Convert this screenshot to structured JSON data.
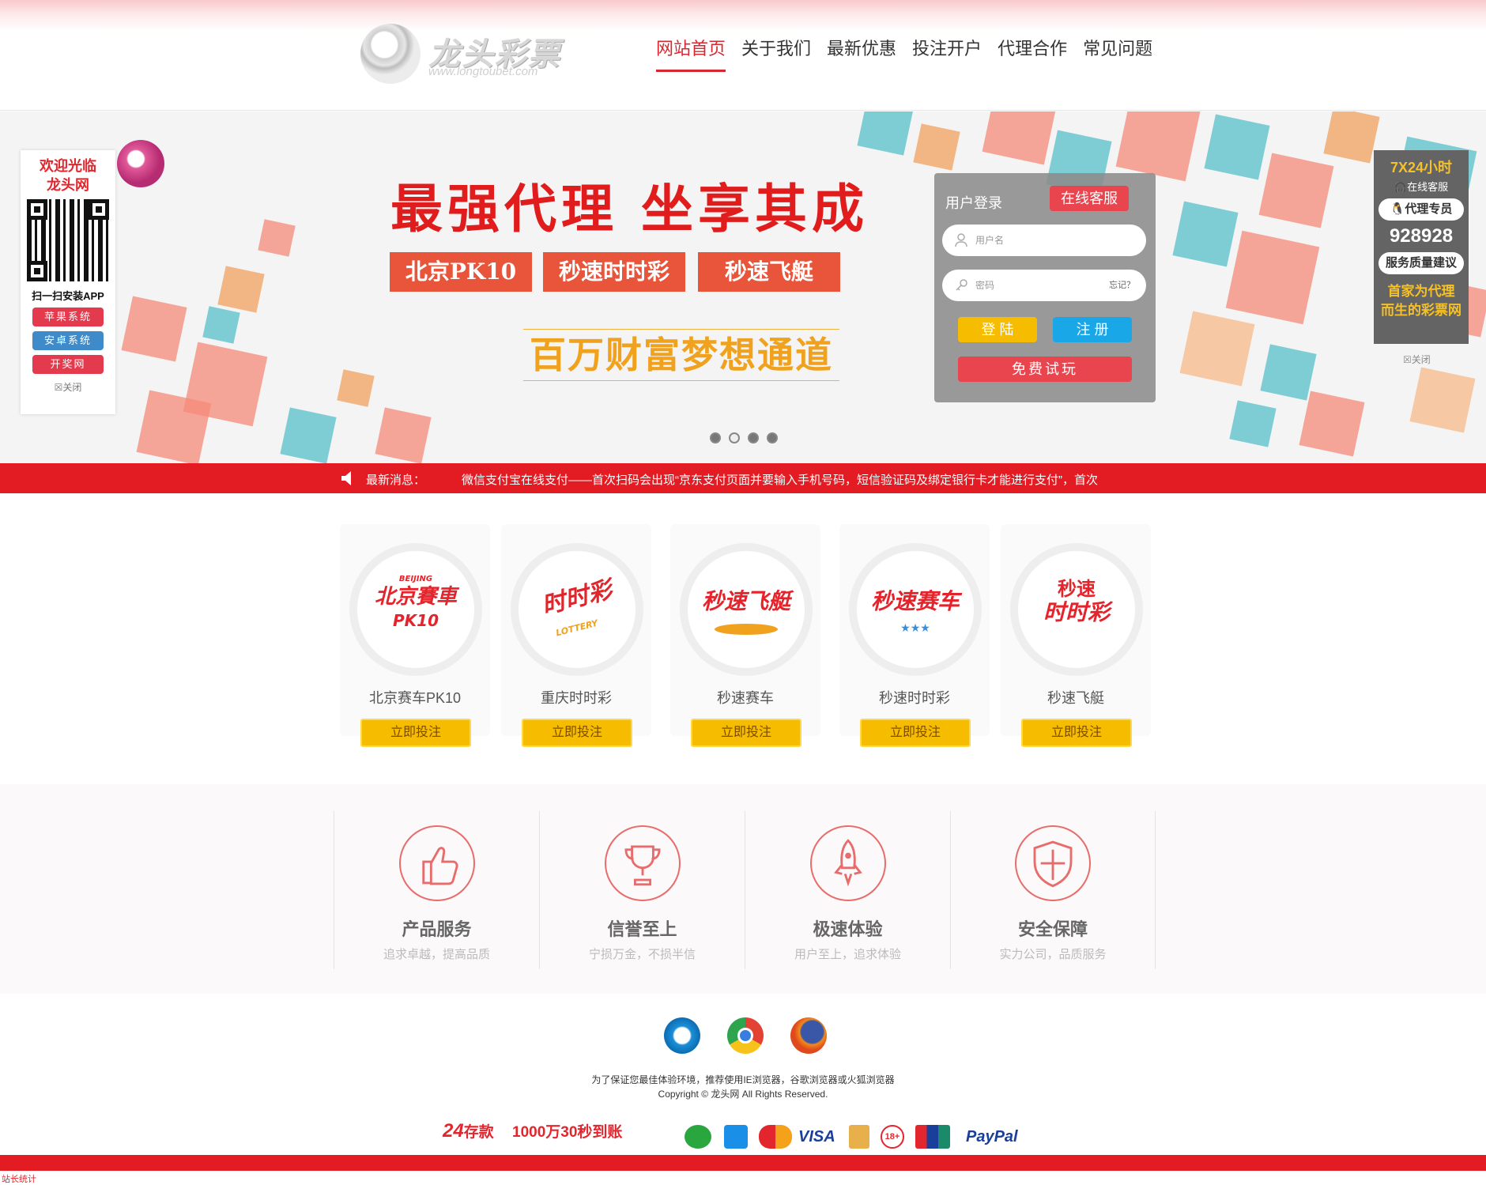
{
  "header": {
    "logo_name": "龙头彩票",
    "logo_url": "www.longtoubet.com",
    "nav": [
      "网站首页",
      "关于我们",
      "最新优惠",
      "投注开户",
      "代理合作",
      "常见问题"
    ]
  },
  "banner": {
    "slogan": "最强代理 坐享其成",
    "tags": [
      "北京PK10",
      "秒速时时彩",
      "秒速飞艇"
    ],
    "dream": "百万财富梦想通道"
  },
  "left_float": {
    "welcome_line1": "欢迎光临",
    "welcome_line2": "龙头网",
    "scan": "扫一扫安装APP",
    "apple": "苹果系统",
    "android": "安卓系统",
    "lottery_site": "开奖网",
    "close": "关闭"
  },
  "right_float": {
    "hours": "7X24小时",
    "online_service": "在线客服",
    "agent": "代理专员",
    "phone": "928928",
    "suggest": "服务质量建议",
    "agent_first_1": "首家为代理",
    "agent_first_2": "而生的彩票网",
    "close": "关闭"
  },
  "login": {
    "title": "用户登录",
    "online_cs": "在线客服",
    "username_placeholder": "用户名",
    "password_placeholder": "密码",
    "forgot": "忘记？",
    "login": "登 陆",
    "register": "注 册",
    "trial": "免费试玩"
  },
  "news": {
    "label": "最新消息：",
    "text": "微信支付宝在线支付——首次扫码会出现“京东支付页面并要输入手机号码，短信验证码及绑定银行卡才能进行支付”，首次"
  },
  "games": [
    {
      "logo_small": "BEIJING",
      "logo_main": "北京賽車",
      "logo_sub": "PK10",
      "name": "北京赛车PK10",
      "bet": "立即投注"
    },
    {
      "logo_main": "时时彩",
      "logo_sub": "LOTTERY",
      "name": "重庆时时彩",
      "bet": "立即投注"
    },
    {
      "logo_main": "秒速飞艇",
      "name": "秒速赛车",
      "bet": "立即投注"
    },
    {
      "logo_main": "秒速赛车",
      "name": "秒速时时彩",
      "bet": "立即投注"
    },
    {
      "logo_main": "秒速",
      "logo_sub": "时时彩",
      "name": "秒速飞艇",
      "bet": "立即投注"
    }
  ],
  "features": [
    {
      "icon": "thumbs-up-icon",
      "title": "产品服务",
      "sub": "追求卓越，提高品质"
    },
    {
      "icon": "trophy-icon",
      "title": "信誉至上",
      "sub": "宁损万金，不损半信"
    },
    {
      "icon": "rocket-icon",
      "title": "极速体验",
      "sub": "用户至上，追求体验"
    },
    {
      "icon": "shield-icon",
      "title": "安全保障",
      "sub": "实力公司，品质服务"
    }
  ],
  "footer": {
    "browsers": [
      "ie-icon",
      "chrome-icon",
      "firefox-icon"
    ],
    "recommend": "为了保证您最佳体验环境，推荐使用IE浏览器，谷歌浏览器或火狐浏览器",
    "copyright": "Copyright © 龙头网 All Rights Reserved.",
    "deposit_24": "24",
    "deposit_label": "存款",
    "deposit_speed": "1000万30秒到账",
    "visa": "VISA",
    "paypal": "PayPal",
    "age": "18+",
    "stat": "站长统计"
  },
  "colors": {
    "brand_red": "#e31b23",
    "accent_yellow": "#f6bd00",
    "nav_active": "#d7282f"
  }
}
